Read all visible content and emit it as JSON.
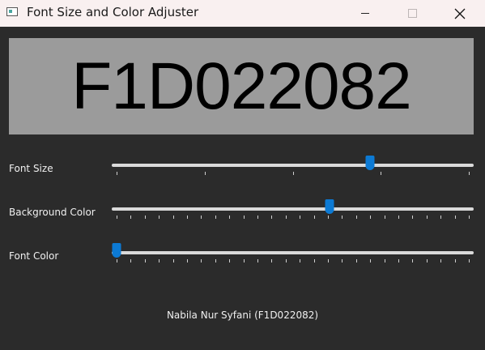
{
  "window": {
    "title": "Font Size and Color Adjuster",
    "icons": {
      "app": "app-window-icon",
      "minimize": "minimize-icon",
      "maximize": "maximize-icon",
      "close": "close-icon"
    },
    "close_glyph": "✕"
  },
  "display": {
    "text": "F1D022082",
    "background_color": "#9b9b9b",
    "text_color": "#000000"
  },
  "sliders": [
    {
      "label": "Font Size",
      "position": 0.72,
      "tick_count": 5
    },
    {
      "label": "Background Color",
      "position": 0.605,
      "tick_count": 26
    },
    {
      "label": "Font Color",
      "position": 0.0,
      "tick_count": 26
    }
  ],
  "footer": {
    "text": "Nabila Nur Syfani (F1D022082)"
  },
  "colors": {
    "accent": "#0c7ad4",
    "window_bg": "#2b2b2b",
    "titlebar_bg": "#f9f0f0"
  }
}
